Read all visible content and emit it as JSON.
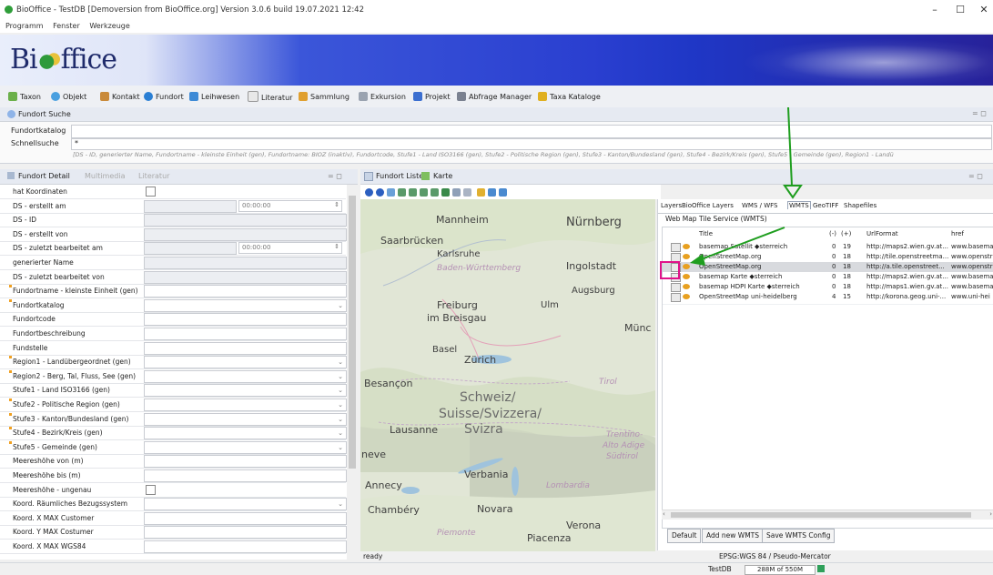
{
  "window": {
    "title": "BioOffice - TestDB [Demoversion from BioOffice.org] Version 3.0.6 build 19.07.2021 12:42",
    "minimize": "–",
    "maximize": "☐",
    "close": "✕"
  },
  "menu": [
    "Programm",
    "Fenster",
    "Werkzeuge"
  ],
  "banner": {
    "logo_left": "Bi",
    "logo_right": "ffice"
  },
  "toolbar": [
    "Taxon",
    "Objekt",
    "Kontakt",
    "Fundort",
    "Leihwesen",
    "Literatur",
    "Sammlung",
    "Exkursion",
    "Projekt",
    "Abfrage Manager",
    "Taxa Kataloge"
  ],
  "search": {
    "header": "Fundort Suche",
    "katalog_label": "Fundortkatalog",
    "schnell_label": "Schnellsuche",
    "schnell_value": "*",
    "hint": "[DS - ID, generierter Name, Fundortname - kleinste Einheit (gen), Fundortname: BIOZ (inaktiv), Fundortcode, Stufe1 - Land ISO3166 (gen), Stufe2 - Politische Region (gen), Stufe3 - Kanton/Bundesland (gen), Stufe4 - Bezirk/Kreis (gen), Stufe5 - Gemeinde (gen), Region1 - Landü"
  },
  "left_panel": {
    "tabs": [
      "Fundort Detail",
      "Multimedia",
      "Literatur"
    ],
    "time_value": "00:00:00",
    "fields": [
      {
        "name": "hat Koordinaten",
        "kind": "check"
      },
      {
        "name": "DS - erstellt am",
        "kind": "time"
      },
      {
        "name": "DS - ID",
        "kind": "ro"
      },
      {
        "name": "DS - erstellt von",
        "kind": "ro"
      },
      {
        "name": "DS - zuletzt bearbeitet am",
        "kind": "time"
      },
      {
        "name": "generierter Name",
        "kind": "ro"
      },
      {
        "name": "DS - zuletzt bearbeitet von",
        "kind": "ro"
      },
      {
        "name": "Fundortname - kleinste Einheit (gen)",
        "kind": "text",
        "mark": true
      },
      {
        "name": "Fundortkatalog",
        "kind": "dropdown",
        "mark": true
      },
      {
        "name": "Fundortcode",
        "kind": "text"
      },
      {
        "name": "Fundortbeschreibung",
        "kind": "text"
      },
      {
        "name": "Fundstelle",
        "kind": "text"
      },
      {
        "name": "Region1 - Landübergeordnet (gen)",
        "kind": "dropdown",
        "mark": true
      },
      {
        "name": "Region2 - Berg, Tal, Fluss, See (gen)",
        "kind": "dropdown",
        "mark": true
      },
      {
        "name": "Stufe1 - Land ISO3166 (gen)",
        "kind": "dropdown"
      },
      {
        "name": "Stufe2 - Politische Region (gen)",
        "kind": "dropdown",
        "mark": true
      },
      {
        "name": "Stufe3 - Kanton/Bundesland (gen)",
        "kind": "dropdown",
        "mark": true
      },
      {
        "name": "Stufe4 - Bezirk/Kreis (gen)",
        "kind": "dropdown",
        "mark": true
      },
      {
        "name": "Stufe5 - Gemeinde (gen)",
        "kind": "dropdown",
        "mark": true
      },
      {
        "name": "Meereshöhe von (m)",
        "kind": "text"
      },
      {
        "name": "Meereshöhe bis (m)",
        "kind": "text"
      },
      {
        "name": "Meereshöhe - ungenau",
        "kind": "check"
      },
      {
        "name": "Koord. Räumliches Bezugssystem",
        "kind": "dropdown"
      },
      {
        "name": "Koord. X MAX Customer",
        "kind": "text"
      },
      {
        "name": "Koord. Y MAX Costumer",
        "kind": "text"
      },
      {
        "name": "Koord. X MAX WGS84",
        "kind": "text"
      }
    ]
  },
  "right_panel": {
    "tabs": [
      "Fundort Liste",
      "Karte"
    ],
    "map_labels": [
      {
        "text": "Mannheim",
        "cls": "city"
      },
      {
        "text": "Nürnberg",
        "cls": "city"
      },
      {
        "text": "Saarbrücken",
        "cls": "city"
      },
      {
        "text": "Karlsruhe",
        "cls": "city"
      },
      {
        "text": "Baden-Württemberg",
        "cls": "region"
      },
      {
        "text": "Ingolstadt",
        "cls": "city"
      },
      {
        "text": "Augsburg",
        "cls": "city"
      },
      {
        "text": "Freiburg",
        "cls": "city"
      },
      {
        "text": "im Breisgau",
        "cls": "city"
      },
      {
        "text": "Ulm",
        "cls": "city"
      },
      {
        "text": "Münc",
        "cls": "city"
      },
      {
        "text": "Basel",
        "cls": "city"
      },
      {
        "text": "Zürich",
        "cls": "city"
      },
      {
        "text": "Besançon",
        "cls": "city"
      },
      {
        "text": "Tirol",
        "cls": "region"
      },
      {
        "text": "Schweiz/",
        "cls": "country"
      },
      {
        "text": "Suisse/Svizzera/",
        "cls": "country"
      },
      {
        "text": "Svizra",
        "cls": "country"
      },
      {
        "text": "Lausanne",
        "cls": "city"
      },
      {
        "text": "Trentino-",
        "cls": "region"
      },
      {
        "text": "Alto Adige",
        "cls": "region"
      },
      {
        "text": "Südtirol",
        "cls": "region"
      },
      {
        "text": "neve",
        "cls": "city"
      },
      {
        "text": "Verbania",
        "cls": "city"
      },
      {
        "text": "Annecy",
        "cls": "city"
      },
      {
        "text": "Lombardia",
        "cls": "region"
      },
      {
        "text": "Chambéry",
        "cls": "city"
      },
      {
        "text": "Novara",
        "cls": "city"
      },
      {
        "text": "Piemonte",
        "cls": "region"
      },
      {
        "text": "Verona",
        "cls": "city"
      },
      {
        "text": "Piacenza",
        "cls": "city"
      }
    ],
    "status": "ready",
    "crs": "EPSG:WGS 84 / Pseudo-Mercator"
  },
  "wmts": {
    "tabs": [
      "Layers",
      "BioOffice Layers",
      "WMS / WFS",
      "WMTS",
      "GeoTIFF",
      "Shapefiles"
    ],
    "active_tab": "WMTS",
    "caption": "Web Map Tile Service (WMTS)",
    "columns": [
      "Title",
      "(-)",
      "(+)",
      "UrlFormat",
      "href"
    ],
    "rows": [
      {
        "title": "basemap Satellit ◆sterreich",
        "min": "0",
        "max": "19",
        "url": "http://maps2.wien.gv.at...",
        "href": "www.basemap"
      },
      {
        "title": "OpenStreetMap.org",
        "min": "0",
        "max": "18",
        "url": "http://tile.openstreetma...",
        "href": "www.openstr"
      },
      {
        "title": "OpenStreetMap.org",
        "min": "0",
        "max": "18",
        "url": "http://a.tile.openstreet...",
        "href": "www.openstr"
      },
      {
        "title": "basemap Karte ◆sterreich",
        "min": "0",
        "max": "18",
        "url": "http://maps2.wien.gv.at...",
        "href": "www.basemap"
      },
      {
        "title": "basemap HDPI Karte ◆sterreich",
        "min": "0",
        "max": "18",
        "url": "http://maps1.wien.gv.at...",
        "href": "www.basemap"
      },
      {
        "title": "OpenStreetMap uni-heidelberg",
        "min": "4",
        "max": "15",
        "url": "http://korona.geog.uni-...",
        "href": "www.uni-hei"
      }
    ],
    "selected_row": 2,
    "buttons": [
      "Default",
      "Add new WMTS",
      "Save WMTS Config"
    ]
  },
  "bottom": {
    "db": "TestDB",
    "memory": "288M of 550M"
  },
  "colors": {
    "annotation_arrow": "#1f9e1f",
    "highlight_box": "#e0128a"
  }
}
